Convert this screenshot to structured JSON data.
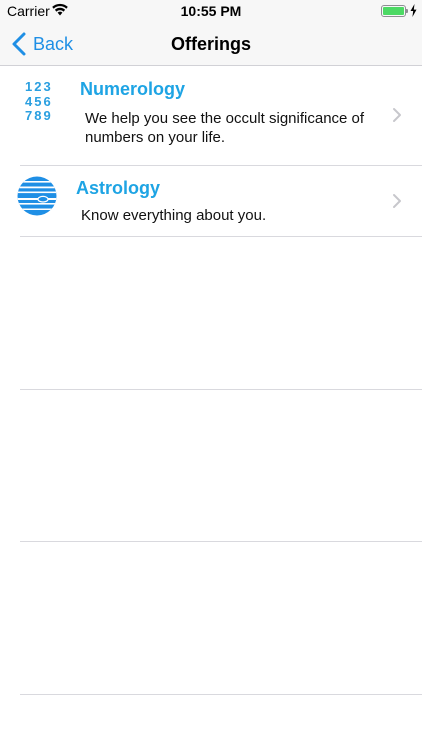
{
  "status_bar": {
    "carrier": "Carrier",
    "time": "10:55 PM",
    "battery_level": 1.0
  },
  "nav": {
    "back_label": "Back",
    "title": "Offerings"
  },
  "offerings": [
    {
      "title": "Numerology",
      "description_line1": "We help you see the occult significance of",
      "description_line2": "numbers on your life.",
      "icon": "numerology-digits-icon",
      "icon_rows": [
        "123",
        "456",
        "789"
      ]
    },
    {
      "title": "Astrology",
      "description_line1": "Know everything about you.",
      "icon": "planet-icon"
    }
  ],
  "colors": {
    "accent": "#1f8fe5",
    "title": "#1ea4e4",
    "icon_blue": "#2a9fe0",
    "battery": "#4cd964"
  }
}
